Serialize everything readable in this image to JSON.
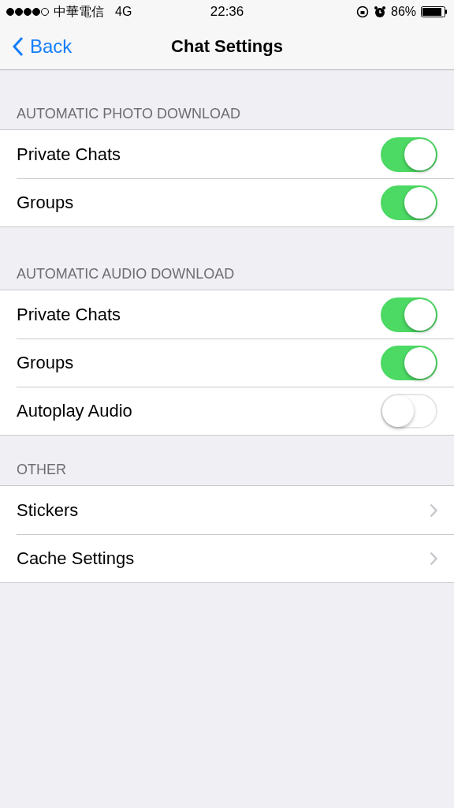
{
  "status_bar": {
    "carrier": "中華電信",
    "network": "4G",
    "time": "22:36",
    "battery": "86%"
  },
  "nav": {
    "back": "Back",
    "title": "Chat Settings"
  },
  "sections": [
    {
      "header": "AUTOMATIC PHOTO DOWNLOAD",
      "rows": [
        {
          "kind": "toggle",
          "label": "Private Chats",
          "on": true
        },
        {
          "kind": "toggle",
          "label": "Groups",
          "on": true
        }
      ]
    },
    {
      "header": "AUTOMATIC AUDIO DOWNLOAD",
      "rows": [
        {
          "kind": "toggle",
          "label": "Private Chats",
          "on": true
        },
        {
          "kind": "toggle",
          "label": "Groups",
          "on": true
        },
        {
          "kind": "toggle",
          "label": "Autoplay Audio",
          "on": false
        }
      ]
    },
    {
      "header": "OTHER",
      "rows": [
        {
          "kind": "link",
          "label": "Stickers"
        },
        {
          "kind": "link",
          "label": "Cache Settings"
        }
      ]
    }
  ]
}
